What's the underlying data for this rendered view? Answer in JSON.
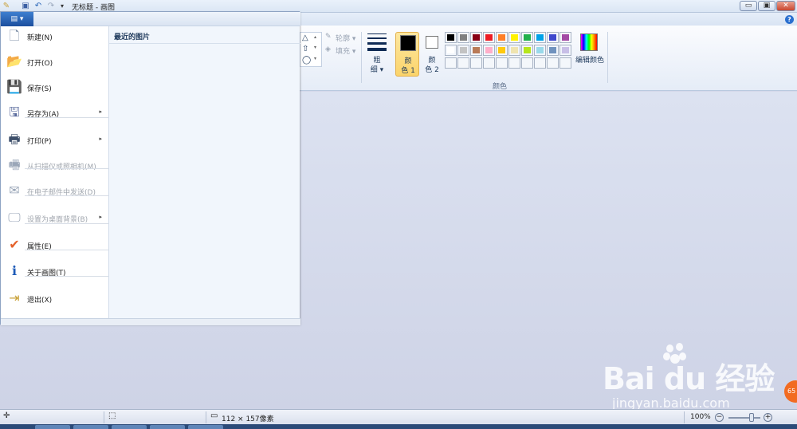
{
  "window": {
    "title": "无标题 - 画图",
    "minimize_glyph": "▭",
    "restore_glyph": "▣",
    "close_glyph": "✕"
  },
  "quick_access": {
    "app_icon": "paint-app-icon",
    "save_icon": "save-icon",
    "undo_icon": "undo-icon",
    "redo_icon": "redo-icon",
    "customize_glyph": "▾"
  },
  "help_glyph": "?",
  "app_menu_button": {
    "label": "▤ ▾"
  },
  "ribbon": {
    "outline_label": "轮廓 ▾",
    "fill_label": "填充 ▾",
    "thickness_label_line1": "粗",
    "thickness_label_line2": "细 ▾",
    "color1_label_line1": "颜",
    "color1_label_line2": "色 1",
    "color2_label_line1": "颜",
    "color2_label_line2": "色 2",
    "color1_value": "#000000",
    "color2_value": "#ffffff",
    "edit_colors_label": "编辑颜色",
    "colors_group_label": "颜色",
    "palette_row1": [
      "#000000",
      "#7f7f7f",
      "#880015",
      "#ed1c24",
      "#ff7f27",
      "#fff200",
      "#22b14c",
      "#00a2e8",
      "#3f48cc",
      "#a349a4"
    ],
    "palette_row2": [
      "#ffffff",
      "#c3c3c3",
      "#b97a57",
      "#ffaec9",
      "#ffc90e",
      "#efe4b0",
      "#b5e61d",
      "#99d9ea",
      "#7092be",
      "#c8bfe7"
    ]
  },
  "menu": {
    "items": [
      {
        "label": "新建(N)",
        "icon": "new-file-icon",
        "glyph": "🗋",
        "disabled": false,
        "submenu": false
      },
      {
        "label": "打开(O)",
        "icon": "open-folder-icon",
        "glyph": "📂",
        "disabled": false,
        "submenu": false
      },
      {
        "label": "保存(S)",
        "icon": "save-icon",
        "glyph": "💾",
        "disabled": false,
        "submenu": false
      },
      {
        "label": "另存为(A)",
        "icon": "save-as-icon",
        "glyph": "🖫",
        "disabled": false,
        "submenu": true
      },
      {
        "label": "打印(P)",
        "icon": "printer-icon",
        "glyph": "🖶",
        "disabled": false,
        "submenu": true
      },
      {
        "label": "从扫描仪或照相机(M)",
        "icon": "scanner-icon",
        "glyph": "🖷",
        "disabled": true,
        "submenu": false
      },
      {
        "label": "在电子邮件中发送(D)",
        "icon": "email-icon",
        "glyph": "✉",
        "disabled": true,
        "submenu": false
      },
      {
        "label": "设置为桌面背景(B)",
        "icon": "desktop-background-icon",
        "glyph": "🖵",
        "disabled": true,
        "submenu": true
      },
      {
        "label": "属性(E)",
        "icon": "checkmark-icon",
        "glyph": "✔",
        "disabled": false,
        "submenu": false
      },
      {
        "label": "关于画图(T)",
        "icon": "info-icon",
        "glyph": "ℹ",
        "disabled": false,
        "submenu": false
      },
      {
        "label": "退出(X)",
        "icon": "exit-icon",
        "glyph": "⇥",
        "disabled": false,
        "submenu": false
      }
    ],
    "recent_title": "最近的图片",
    "submenu_glyph": "▸"
  },
  "status": {
    "cursor_icon": "cursor-position-icon",
    "selection_icon": "selection-size-icon",
    "canvas_size_icon": "canvas-size-icon",
    "canvas_size": "112 × 157像素",
    "zoom": "100%",
    "zoom_out_glyph": "−",
    "zoom_in_glyph": "+"
  },
  "watermark": {
    "main": "Bai du 经验",
    "sub": "jingyan.baidu.com"
  },
  "badge": "65"
}
